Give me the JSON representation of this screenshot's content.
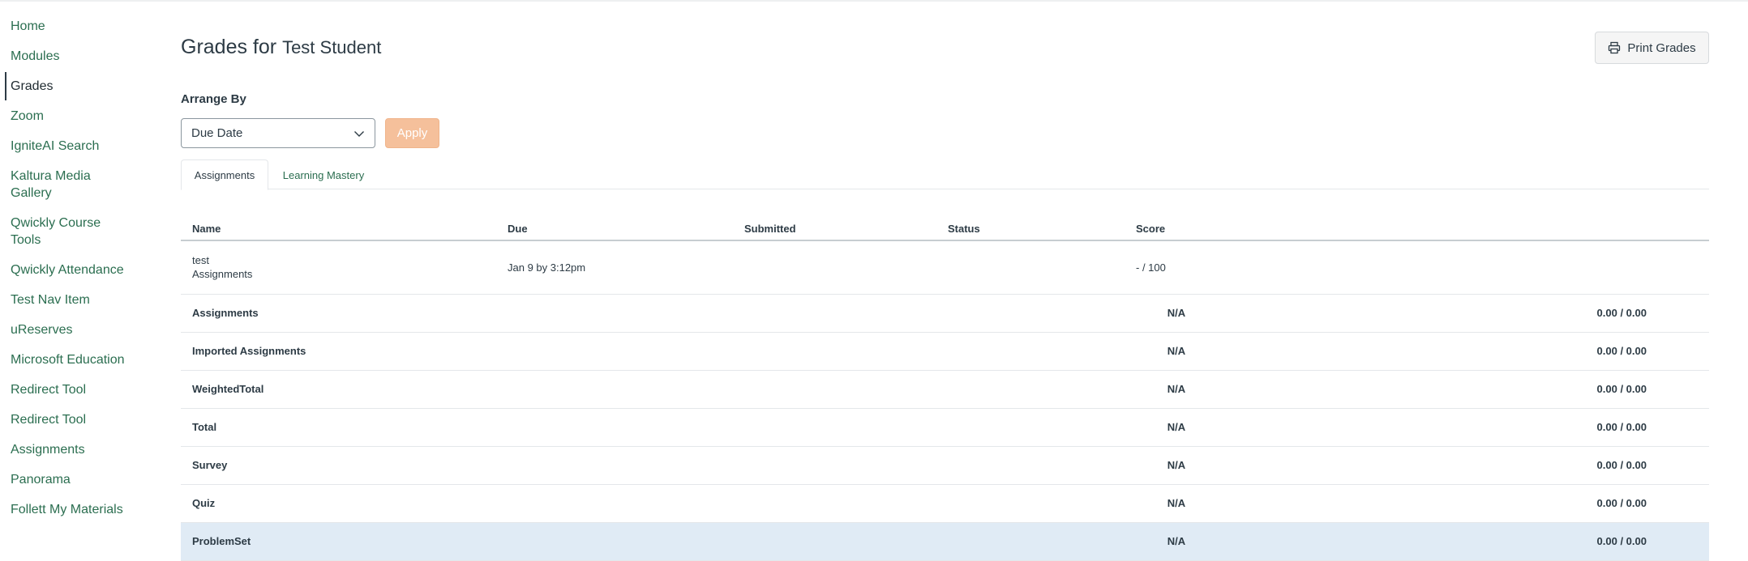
{
  "sidebar": {
    "items": [
      {
        "label": "Home"
      },
      {
        "label": "Modules"
      },
      {
        "label": "Grades"
      },
      {
        "label": "Zoom"
      },
      {
        "label": "IgniteAI Search"
      },
      {
        "label": "Kaltura Media Gallery"
      },
      {
        "label": "Qwickly Course Tools"
      },
      {
        "label": "Qwickly Attendance"
      },
      {
        "label": "Test Nav Item"
      },
      {
        "label": "uReserves"
      },
      {
        "label": "Microsoft Education"
      },
      {
        "label": "Redirect Tool"
      },
      {
        "label": "Redirect Tool"
      },
      {
        "label": "Assignments"
      },
      {
        "label": "Panorama"
      },
      {
        "label": "Follett My Materials"
      }
    ]
  },
  "header": {
    "title_prefix": "Grades for",
    "student_name": "Test Student",
    "print_label": "Print Grades"
  },
  "arrange": {
    "label": "Arrange By",
    "selected": "Due Date",
    "apply_label": "Apply"
  },
  "tabs": [
    {
      "label": "Assignments"
    },
    {
      "label": "Learning Mastery"
    }
  ],
  "table": {
    "columns": [
      "Name",
      "Due",
      "Submitted",
      "Status",
      "Score"
    ],
    "assignment": {
      "name": "test",
      "group": "Assignments",
      "due": "Jan 9 by 3:12pm",
      "submitted": "",
      "status": "",
      "score": "- / 100"
    },
    "groups": [
      {
        "name": "Assignments",
        "score": "N/A",
        "total": "0.00 / 0.00"
      },
      {
        "name": "Imported Assignments",
        "score": "N/A",
        "total": "0.00 / 0.00"
      },
      {
        "name": "WeightedTotal",
        "score": "N/A",
        "total": "0.00 / 0.00"
      },
      {
        "name": "Total",
        "score": "N/A",
        "total": "0.00 / 0.00"
      },
      {
        "name": "Survey",
        "score": "N/A",
        "total": "0.00 / 0.00"
      },
      {
        "name": "Quiz",
        "score": "N/A",
        "total": "0.00 / 0.00"
      },
      {
        "name": "ProblemSet",
        "score": "N/A",
        "total": "0.00 / 0.00"
      }
    ]
  },
  "colors": {
    "link": "#2b6e50",
    "text": "#2d3b45",
    "apply_bg": "#f5c09b",
    "highlight_row": "#e0ebf5"
  }
}
